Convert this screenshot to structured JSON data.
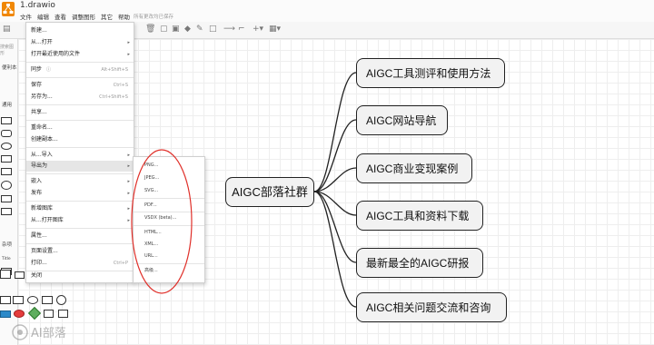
{
  "app": {
    "file_title": "1.drawio",
    "save_status": "所有更改均已保存"
  },
  "menubar": [
    "文件",
    "编辑",
    "查看",
    "调整图形",
    "其它",
    "帮助"
  ],
  "sidebar": {
    "search_placeholder": "搜索图形",
    "section_favorites": "便利本",
    "section_general": "通用",
    "section_misc": "杂项",
    "small_label": "Title"
  },
  "file_menu": [
    {
      "label": "新建..."
    },
    {
      "label": "从...打开",
      "submenu": true
    },
    {
      "label": "打开最近使用的文件",
      "submenu": true
    },
    {
      "label": "同步",
      "shortcut": "Alt+Shift+S",
      "help": true
    },
    {
      "label": "保存",
      "shortcut": "Ctrl+S"
    },
    {
      "label": "另存为...",
      "shortcut": "Ctrl+Shift+S"
    },
    {
      "label": "共享..."
    },
    {
      "label": "重命名..."
    },
    {
      "label": "创建副本..."
    },
    {
      "label": "从...导入",
      "submenu": true
    },
    {
      "label": "导出为",
      "submenu": true,
      "highlighted": true
    },
    {
      "label": "嵌入",
      "submenu": true
    },
    {
      "label": "发布",
      "submenu": true
    },
    {
      "label": "新增图库",
      "submenu": true
    },
    {
      "label": "从...打开图库",
      "submenu": true
    },
    {
      "label": "属性..."
    },
    {
      "label": "页面设置..."
    },
    {
      "label": "打印...",
      "shortcut": "Ctrl+P"
    },
    {
      "label": "关闭"
    }
  ],
  "export_menu": [
    "PNG...",
    "JPEG...",
    "SVG...",
    "PDF...",
    "VSDX (beta)...",
    "HTML...",
    "XML...",
    "URL...",
    "高级..."
  ],
  "mindmap": {
    "center": "AIGC部落社群",
    "children": [
      "AIGC工具测评和使用方法",
      "AIGC网站导航",
      "AIGC商业变现案例",
      "AIGC工具和资料下载",
      "最新最全的AIGC研报",
      "AIGC相关问题交流和咨询"
    ]
  },
  "annotation": {
    "shape": "ellipse",
    "color": "#e0302a"
  },
  "watermark": "AI部落"
}
